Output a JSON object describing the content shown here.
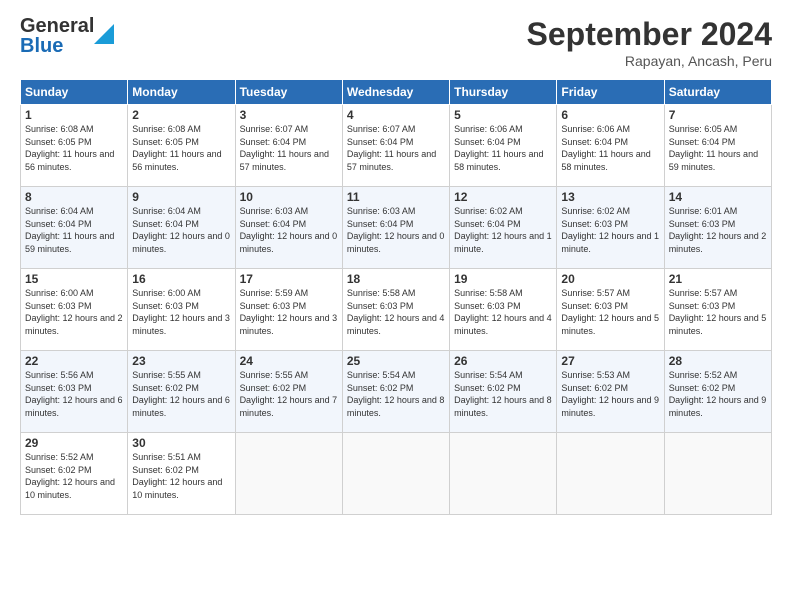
{
  "header": {
    "logo_top": "General",
    "logo_bottom": "Blue",
    "title": "September 2024",
    "location": "Rapayan, Ancash, Peru"
  },
  "days": [
    "Sunday",
    "Monday",
    "Tuesday",
    "Wednesday",
    "Thursday",
    "Friday",
    "Saturday"
  ],
  "weeks": [
    [
      {
        "day": "1",
        "sunrise": "6:08 AM",
        "sunset": "6:05 PM",
        "daylight": "11 hours and 56 minutes."
      },
      {
        "day": "2",
        "sunrise": "6:08 AM",
        "sunset": "6:05 PM",
        "daylight": "11 hours and 56 minutes."
      },
      {
        "day": "3",
        "sunrise": "6:07 AM",
        "sunset": "6:04 PM",
        "daylight": "11 hours and 57 minutes."
      },
      {
        "day": "4",
        "sunrise": "6:07 AM",
        "sunset": "6:04 PM",
        "daylight": "11 hours and 57 minutes."
      },
      {
        "day": "5",
        "sunrise": "6:06 AM",
        "sunset": "6:04 PM",
        "daylight": "11 hours and 58 minutes."
      },
      {
        "day": "6",
        "sunrise": "6:06 AM",
        "sunset": "6:04 PM",
        "daylight": "11 hours and 58 minutes."
      },
      {
        "day": "7",
        "sunrise": "6:05 AM",
        "sunset": "6:04 PM",
        "daylight": "11 hours and 59 minutes."
      }
    ],
    [
      {
        "day": "8",
        "sunrise": "6:04 AM",
        "sunset": "6:04 PM",
        "daylight": "11 hours and 59 minutes."
      },
      {
        "day": "9",
        "sunrise": "6:04 AM",
        "sunset": "6:04 PM",
        "daylight": "12 hours and 0 minutes."
      },
      {
        "day": "10",
        "sunrise": "6:03 AM",
        "sunset": "6:04 PM",
        "daylight": "12 hours and 0 minutes."
      },
      {
        "day": "11",
        "sunrise": "6:03 AM",
        "sunset": "6:04 PM",
        "daylight": "12 hours and 0 minutes."
      },
      {
        "day": "12",
        "sunrise": "6:02 AM",
        "sunset": "6:04 PM",
        "daylight": "12 hours and 1 minute."
      },
      {
        "day": "13",
        "sunrise": "6:02 AM",
        "sunset": "6:03 PM",
        "daylight": "12 hours and 1 minute."
      },
      {
        "day": "14",
        "sunrise": "6:01 AM",
        "sunset": "6:03 PM",
        "daylight": "12 hours and 2 minutes."
      }
    ],
    [
      {
        "day": "15",
        "sunrise": "6:00 AM",
        "sunset": "6:03 PM",
        "daylight": "12 hours and 2 minutes."
      },
      {
        "day": "16",
        "sunrise": "6:00 AM",
        "sunset": "6:03 PM",
        "daylight": "12 hours and 3 minutes."
      },
      {
        "day": "17",
        "sunrise": "5:59 AM",
        "sunset": "6:03 PM",
        "daylight": "12 hours and 3 minutes."
      },
      {
        "day": "18",
        "sunrise": "5:58 AM",
        "sunset": "6:03 PM",
        "daylight": "12 hours and 4 minutes."
      },
      {
        "day": "19",
        "sunrise": "5:58 AM",
        "sunset": "6:03 PM",
        "daylight": "12 hours and 4 minutes."
      },
      {
        "day": "20",
        "sunrise": "5:57 AM",
        "sunset": "6:03 PM",
        "daylight": "12 hours and 5 minutes."
      },
      {
        "day": "21",
        "sunrise": "5:57 AM",
        "sunset": "6:03 PM",
        "daylight": "12 hours and 5 minutes."
      }
    ],
    [
      {
        "day": "22",
        "sunrise": "5:56 AM",
        "sunset": "6:03 PM",
        "daylight": "12 hours and 6 minutes."
      },
      {
        "day": "23",
        "sunrise": "5:55 AM",
        "sunset": "6:02 PM",
        "daylight": "12 hours and 6 minutes."
      },
      {
        "day": "24",
        "sunrise": "5:55 AM",
        "sunset": "6:02 PM",
        "daylight": "12 hours and 7 minutes."
      },
      {
        "day": "25",
        "sunrise": "5:54 AM",
        "sunset": "6:02 PM",
        "daylight": "12 hours and 8 minutes."
      },
      {
        "day": "26",
        "sunrise": "5:54 AM",
        "sunset": "6:02 PM",
        "daylight": "12 hours and 8 minutes."
      },
      {
        "day": "27",
        "sunrise": "5:53 AM",
        "sunset": "6:02 PM",
        "daylight": "12 hours and 9 minutes."
      },
      {
        "day": "28",
        "sunrise": "5:52 AM",
        "sunset": "6:02 PM",
        "daylight": "12 hours and 9 minutes."
      }
    ],
    [
      {
        "day": "29",
        "sunrise": "5:52 AM",
        "sunset": "6:02 PM",
        "daylight": "12 hours and 10 minutes."
      },
      {
        "day": "30",
        "sunrise": "5:51 AM",
        "sunset": "6:02 PM",
        "daylight": "12 hours and 10 minutes."
      },
      null,
      null,
      null,
      null,
      null
    ]
  ]
}
